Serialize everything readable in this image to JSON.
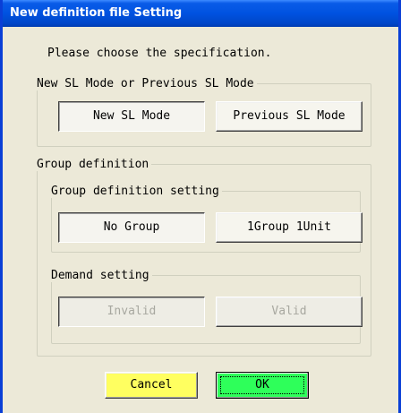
{
  "window": {
    "title": "New definition file Setting"
  },
  "prompt": "Please choose the specification.",
  "sl_mode_group": {
    "legend": "New SL Mode or Previous SL Mode",
    "new_label": "New SL Mode",
    "previous_label": "Previous SL Mode",
    "selected": "New SL Mode"
  },
  "group_definition": {
    "legend": "Group definition",
    "setting": {
      "legend": "Group definition setting",
      "no_group_label": "No Group",
      "one_group_label": "1Group 1Unit",
      "selected": "No Group"
    },
    "demand": {
      "legend": "Demand setting",
      "invalid_label": "Invalid",
      "valid_label": "Valid",
      "enabled": false
    }
  },
  "footer": {
    "cancel_label": "Cancel",
    "ok_label": "OK"
  },
  "colors": {
    "title_bar": "#0052e0",
    "dialog_bg": "#ece9d8",
    "cancel_button": "#ffff60",
    "ok_button": "#2eff5a",
    "disabled_text": "#a8a8a0"
  }
}
